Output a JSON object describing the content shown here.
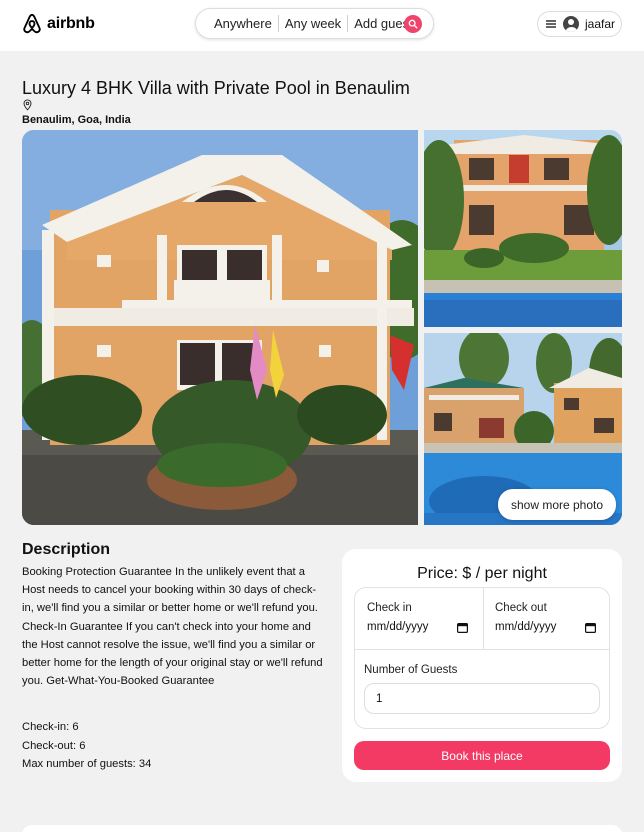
{
  "header": {
    "brand": "airbnb",
    "search": {
      "where": "Anywhere",
      "when": "Any week",
      "guests": "Add guests"
    },
    "user_name": "jaafar",
    "accent_color": "#f23a64"
  },
  "listing": {
    "title": "Luxury 4 BHK Villa with Private Pool in Benaulim",
    "location": "Benaulim, Goa, India",
    "photos": [
      "villa-front-photo",
      "villa-garden-photo",
      "villa-pool-photo"
    ],
    "show_more_label": "show more photo"
  },
  "description": {
    "heading": "Description",
    "text": "Booking Protection Guarantee In the unlikely event that a Host needs to cancel your booking within 30 days of check-in, we'll find you a similar or better home or we'll refund you. Check-In Guarantee If you can't check into your home and the Host cannot resolve the issue, we'll find you a similar or better home for the length of your original stay or we'll refund you. Get-What-You-Booked Guarantee",
    "check_in": "Check-in: 6",
    "check_out": "Check-out: 6",
    "max_guests": "Max number of guests: 34"
  },
  "booking": {
    "price_label": "Price: $ / per night",
    "check_in_label": "Check in",
    "check_in_value": "mm/dd/yyyy",
    "check_out_label": "Check out",
    "check_out_value": "mm/dd/yyyy",
    "guests_label": "Number of Guests",
    "guests_value": "1",
    "book_label": "Book this place"
  }
}
